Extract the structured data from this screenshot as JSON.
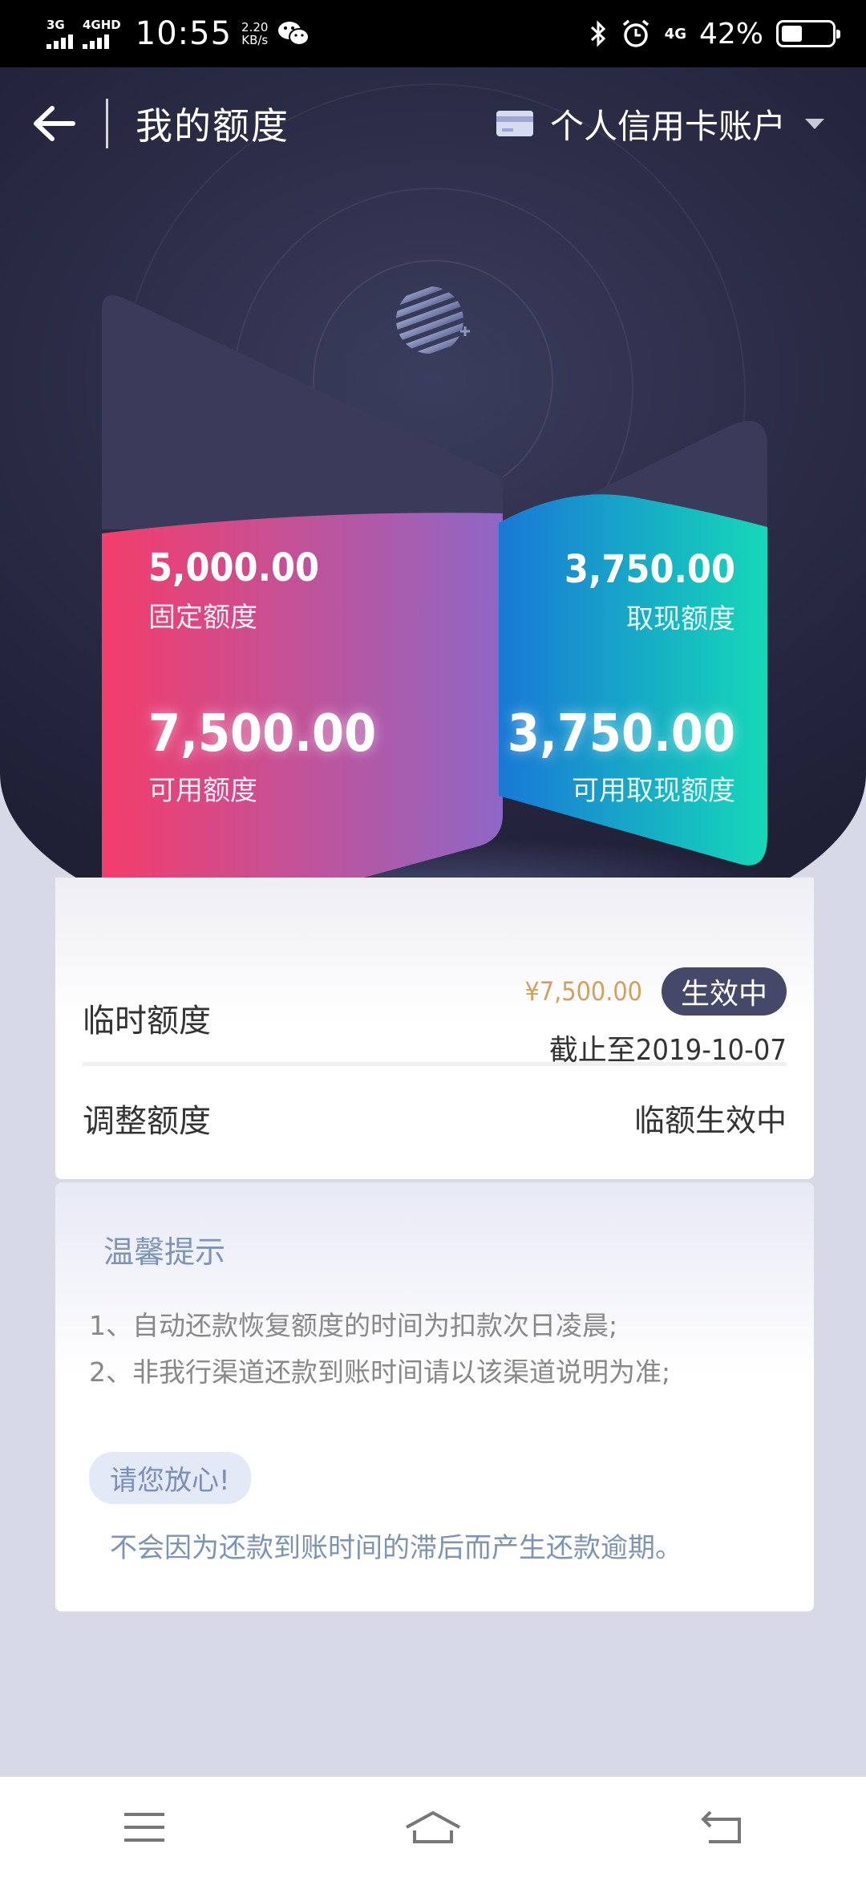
{
  "status_bar": {
    "net1": "3G",
    "net2": "4GHD",
    "time": "10:55",
    "speed_value": "2.20",
    "speed_unit": "KB/s",
    "network_type": "4G",
    "battery_text": "42%",
    "battery_level": 0.42
  },
  "nav": {
    "title": "我的额度",
    "account": "个人信用卡账户"
  },
  "limits": {
    "fixed_value": "5,000.00",
    "fixed_label": "固定额度",
    "available_value": "7,500.00",
    "available_label": "可用额度",
    "cash_value": "3,750.00",
    "cash_label": "取现额度",
    "available_cash_value": "3,750.00",
    "available_cash_label": "可用取现额度"
  },
  "temp_limit": {
    "label": "临时额度",
    "amount": "¥7,500.00",
    "status": "生效中",
    "until_prefix": "截止至",
    "until_date": "2019-10-07"
  },
  "adjust_limit": {
    "label": "调整额度",
    "status": "临额生效中"
  },
  "tips": {
    "title": "温馨提示",
    "items": [
      "1、自动还款恢复额度的时间为扣款次日凌晨;",
      "2、非我行渠道还款到账时间请以该渠道说明为准;"
    ],
    "reassure_badge": "请您放心!",
    "reassure_text": "不会因为还款到账时间的滞后而产生还款逾期。"
  },
  "colors": {
    "hero_bg": "#2a2b45",
    "left_panel_start": "#f43d6b",
    "left_panel_end": "#8e67c6",
    "right_panel_start": "#1978d6",
    "right_panel_end": "#15d8b8",
    "badge_bg": "#454868",
    "amount_gold": "#d3a15e"
  }
}
